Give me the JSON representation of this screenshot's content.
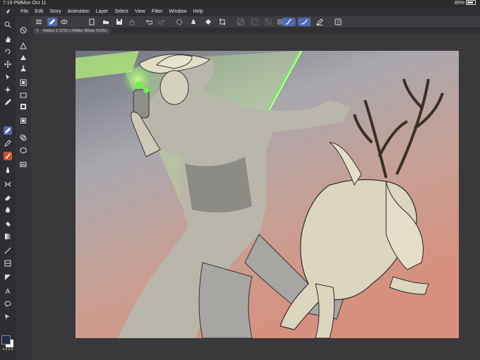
{
  "status": {
    "time": "7:19 PM",
    "date": "Mon Oct 11",
    "battery": "85%"
  },
  "menu": [
    "File",
    "Edit",
    "Story",
    "Animation",
    "Layer",
    "Select",
    "View",
    "Filter",
    "Window",
    "Help"
  ],
  "document_tab": {
    "label": "Hebber 3 (2732 x 2048px 300dpi 79.8%)"
  },
  "toolbar_icons": [
    "menu-icon",
    "brush-tool-icon",
    "eye-icon",
    "new-file-icon",
    "open-file-icon",
    "save-icon",
    "share-icon",
    "upload-icon",
    "undo-icon",
    "redo-icon",
    "loading-icon",
    "clear-icon",
    "fill-icon",
    "transform-icon",
    "eraser-slash-icon",
    "select-all-icon",
    "deselect-icon",
    "invert-icon",
    "hide-icon",
    "stabilizer-icon",
    "pen-pressure-icon",
    "edit-icon",
    "help-icon"
  ],
  "tools": [
    "zoom-icon",
    "hand-icon",
    "rotate-icon",
    "move-icon",
    "operation-icon",
    "sparkle-icon",
    "eyedropper-icon",
    "pen-icon",
    "pencil-icon",
    "brush-icon",
    "airbrush-icon",
    "decoration-icon",
    "eraser-icon",
    "blend-icon",
    "fill-bucket-icon",
    "gradient-icon",
    "figure-icon",
    "frame-icon",
    "ruler-icon",
    "text-icon",
    "balloon-icon",
    "correct-line-icon"
  ],
  "colors": {
    "accent": "#5368b4",
    "main_color": "#242a4a",
    "sub_color": "#ffffff",
    "lightning": "#6df24a"
  }
}
